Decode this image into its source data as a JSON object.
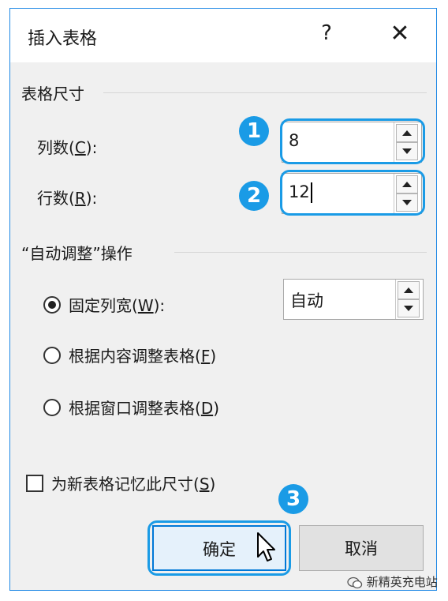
{
  "window": {
    "title": "插入表格",
    "help_label": "?",
    "close_label": "✕"
  },
  "table_size": {
    "title": "表格尺寸",
    "columns_label_prefix": "列数(",
    "columns_hotkey": "C",
    "columns_label_suffix": "):",
    "columns_value": "8",
    "rows_label_prefix": "行数(",
    "rows_hotkey": "R",
    "rows_label_suffix": "):",
    "rows_value": "12"
  },
  "autofit": {
    "title": "“自动调整”操作",
    "fixed_label_prefix": "固定列宽(",
    "fixed_hotkey": "W",
    "fixed_label_suffix": "):",
    "fixed_selected": true,
    "fixed_value": "自动",
    "content_label_prefix": "根据内容调整表格(",
    "content_hotkey": "F",
    "content_label_suffix": ")",
    "window_label_prefix": "根据窗口调整表格(",
    "window_hotkey": "D",
    "window_label_suffix": ")"
  },
  "remember": {
    "label_prefix": "为新表格记忆此尺寸(",
    "hotkey": "S",
    "label_suffix": ")",
    "checked": false
  },
  "buttons": {
    "ok": "确定",
    "cancel": "取消"
  },
  "annotations": {
    "step1": "1",
    "step2": "2",
    "step3": "3"
  },
  "watermark": "新精英充电站",
  "colors": {
    "accent": "#1a9be6",
    "dialog_bg": "#f0f0f0",
    "border": "#1e88e5"
  }
}
